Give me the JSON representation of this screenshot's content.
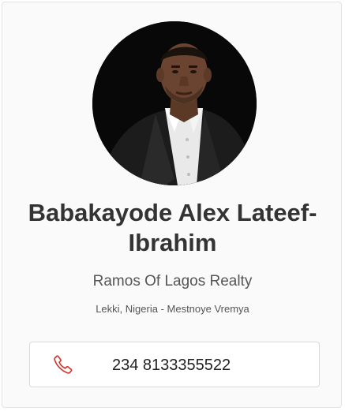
{
  "profile": {
    "name": "Babakayode Alex Lateef-Ibrahim",
    "name_line1": "Babakayode Alex Lateef-",
    "name_line2": "Ibrahim",
    "company": "Ramos Of Lagos Realty",
    "location": "Lekki, Nigeria - Mestnoye Vremya",
    "phone": "234 8133355522"
  },
  "icons": {
    "phone": "phone-icon"
  },
  "colors": {
    "accent": "#d0342c",
    "text": "#333333",
    "muted": "#555555",
    "border": "#d9d9d9"
  }
}
